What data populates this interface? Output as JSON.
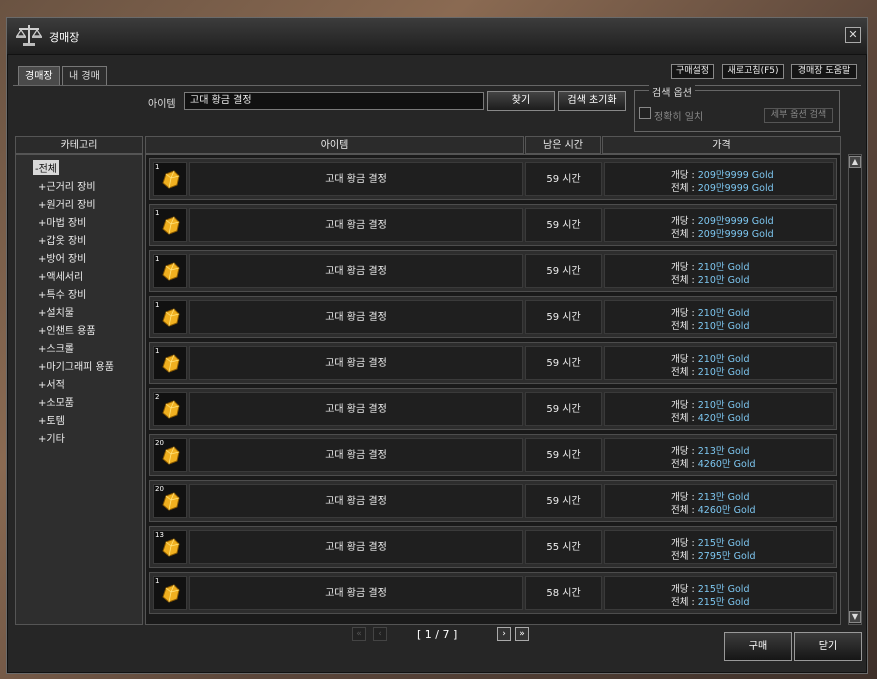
{
  "window": {
    "title": "경매장",
    "close_icon": "✕"
  },
  "tabs": [
    {
      "label": "경매장",
      "active": true
    },
    {
      "label": "내 경매",
      "active": false
    }
  ],
  "top_buttons": {
    "purchase_settings": "구매설정",
    "refresh": "새로고침(F5)",
    "help": "경매장 도움말"
  },
  "search": {
    "item_label": "아이템",
    "item_value": "고대 황금 결정",
    "find_button": "찾기",
    "reset_button": "검색 초기화",
    "options_legend": "검색 옵션",
    "exact_match_label": "정확히 일치",
    "exact_match_checked": false,
    "detail_options_button": "세부 옵션 검색"
  },
  "headers": {
    "category": "카테고리",
    "item": "아이템",
    "time_left": "남은 시간",
    "price": "가격"
  },
  "categories": [
    {
      "label": "-전체",
      "selected": true
    },
    {
      "label": "+근거리 장비"
    },
    {
      "label": "+원거리 장비"
    },
    {
      "label": "+마법 장비"
    },
    {
      "label": "+갑옷 장비"
    },
    {
      "label": "+방어 장비"
    },
    {
      "label": "+액세서리"
    },
    {
      "label": "+특수 장비"
    },
    {
      "label": "+설치물"
    },
    {
      "label": "+인챈트 용품"
    },
    {
      "label": "+스크롤"
    },
    {
      "label": "+마기그래피 용품"
    },
    {
      "label": "+서적"
    },
    {
      "label": "+소모품"
    },
    {
      "label": "+토템"
    },
    {
      "label": "+기타"
    }
  ],
  "price_labels": {
    "each": "개당 : ",
    "total": "전체 : "
  },
  "listings": [
    {
      "qty": "1",
      "name": "고대 황금 결정",
      "time": "59 시간",
      "each": "209만9999 Gold",
      "total": "209만9999 Gold"
    },
    {
      "qty": "1",
      "name": "고대 황금 결정",
      "time": "59 시간",
      "each": "209만9999 Gold",
      "total": "209만9999 Gold"
    },
    {
      "qty": "1",
      "name": "고대 황금 결정",
      "time": "59 시간",
      "each": "210만 Gold",
      "total": "210만 Gold"
    },
    {
      "qty": "1",
      "name": "고대 황금 결정",
      "time": "59 시간",
      "each": "210만 Gold",
      "total": "210만 Gold"
    },
    {
      "qty": "1",
      "name": "고대 황금 결정",
      "time": "59 시간",
      "each": "210만 Gold",
      "total": "210만 Gold"
    },
    {
      "qty": "2",
      "name": "고대 황금 결정",
      "time": "59 시간",
      "each": "210만 Gold",
      "total": "420만 Gold"
    },
    {
      "qty": "20",
      "name": "고대 황금 결정",
      "time": "59 시간",
      "each": "213만 Gold",
      "total": "4260만 Gold"
    },
    {
      "qty": "20",
      "name": "고대 황금 결정",
      "time": "59 시간",
      "each": "213만 Gold",
      "total": "4260만 Gold"
    },
    {
      "qty": "13",
      "name": "고대 황금 결정",
      "time": "55 시간",
      "each": "215만 Gold",
      "total": "2795만 Gold"
    },
    {
      "qty": "1",
      "name": "고대 황금 결정",
      "time": "58 시간",
      "each": "215만 Gold",
      "total": "215만 Gold"
    }
  ],
  "pagination": {
    "text": "[ 1 / 7 ]",
    "first": "«",
    "prev": "‹",
    "next": "›",
    "last": "»"
  },
  "actions": {
    "buy": "구매",
    "close": "닫기"
  },
  "colors": {
    "price_value": "#7ec8f2",
    "gold_item": "#f0b020"
  }
}
